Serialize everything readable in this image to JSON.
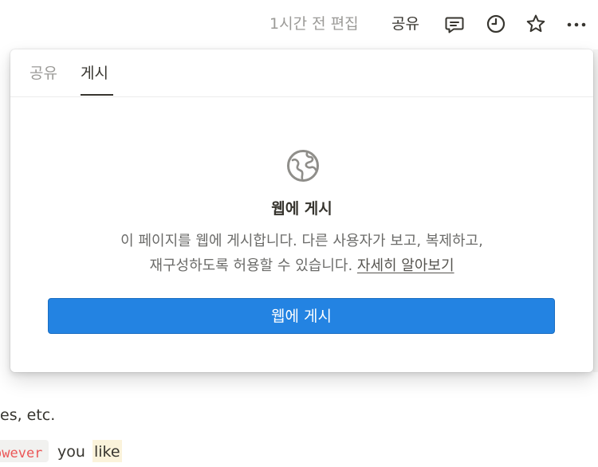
{
  "topbar": {
    "edited_text": "1시간 전 편집",
    "share_label": "공유",
    "icons": [
      "comment-icon",
      "clock-icon",
      "star-icon",
      "more-icon"
    ]
  },
  "popover": {
    "tabs": [
      {
        "label": "공유",
        "active": false
      },
      {
        "label": "게시",
        "active": true
      }
    ],
    "globe_icon": "globe-icon",
    "title": "웹에 게시",
    "description_line1": "이 페이지를 웹에 게시합니다. 다른 사용자가 보고, 복제하고,",
    "description_line2": "재구성하도록 허용할 수 있습니다.",
    "learn_more": "자세히 알아보기",
    "publish_button": "웹에 게시"
  },
  "page": {
    "text_line1": "es, etc.",
    "code_snippet": "owever",
    "text_plain": "you",
    "text_highlighted": "like"
  },
  "colors": {
    "accent": "#2383e2",
    "text": "#37352f",
    "muted": "#9b9a97",
    "code": "#eb5757",
    "highlight": "#fbf3db"
  }
}
